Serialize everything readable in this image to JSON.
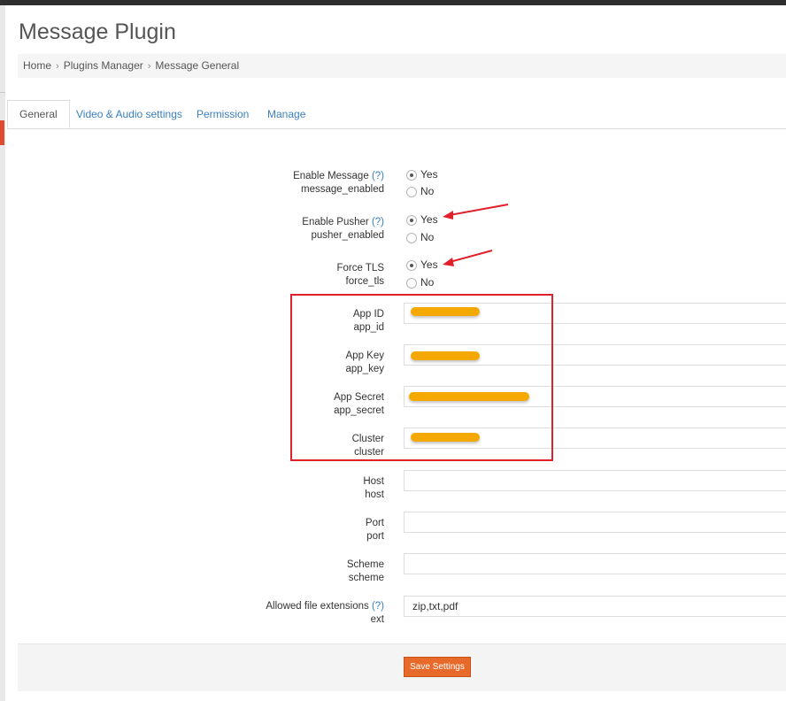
{
  "page": {
    "title": "Message Plugin",
    "breadcrumb": [
      "Home",
      "Plugins Manager",
      "Message General"
    ]
  },
  "tabs": [
    {
      "label": "General",
      "active": true
    },
    {
      "label": "Video & Audio settings",
      "active": false
    },
    {
      "label": "Permission",
      "active": false
    },
    {
      "label": "Manage",
      "active": false
    }
  ],
  "form": {
    "enable_message": {
      "label": "Enable Message",
      "help": "(?)",
      "key": "message_enabled",
      "options": [
        "Yes",
        "No"
      ],
      "selected": "Yes"
    },
    "enable_pusher": {
      "label": "Enable Pusher",
      "help": "(?)",
      "key": "pusher_enabled",
      "options": [
        "Yes",
        "No"
      ],
      "selected": "Yes"
    },
    "force_tls": {
      "label": "Force TLS",
      "key": "force_tls",
      "options": [
        "Yes",
        "No"
      ],
      "selected": "Yes"
    },
    "app_id": {
      "label": "App ID",
      "key": "app_id",
      "value": ""
    },
    "app_key": {
      "label": "App Key",
      "key": "app_key",
      "value": ""
    },
    "app_secret": {
      "label": "App Secret",
      "key": "app_secret",
      "value": ""
    },
    "cluster": {
      "label": "Cluster",
      "key": "cluster",
      "value": ""
    },
    "host": {
      "label": "Host",
      "key": "host",
      "value": ""
    },
    "port": {
      "label": "Port",
      "key": "port",
      "value": ""
    },
    "scheme": {
      "label": "Scheme",
      "key": "scheme",
      "value": ""
    },
    "ext": {
      "label": "Allowed file extensions",
      "help": "(?)",
      "key": "ext",
      "value": "zip,txt,pdf"
    }
  },
  "actions": {
    "save_label": "Save Settings"
  },
  "colors": {
    "accent_link": "#3a7fbf",
    "save_button": "#e86a2a",
    "annotation_red": "#e0202a",
    "redaction": "#f5a800"
  },
  "icons": {
    "breadcrumb_separator": "chevron-right-icon",
    "annotation": "arrow-icon"
  }
}
